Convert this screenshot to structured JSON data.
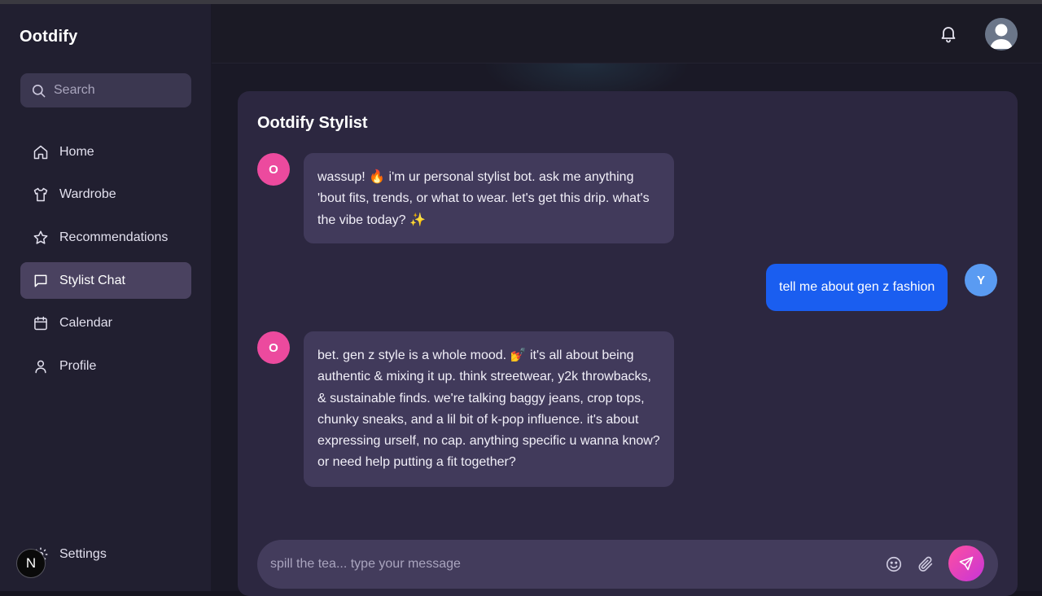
{
  "app": {
    "name": "Ootdify"
  },
  "search": {
    "placeholder": "Search"
  },
  "sidebar": {
    "items": [
      {
        "label": "Home",
        "icon": "home-icon"
      },
      {
        "label": "Wardrobe",
        "icon": "shirt-icon"
      },
      {
        "label": "Recommendations",
        "icon": "star-icon"
      },
      {
        "label": "Stylist Chat",
        "icon": "chat-icon",
        "active": true
      },
      {
        "label": "Calendar",
        "icon": "calendar-icon"
      },
      {
        "label": "Profile",
        "icon": "user-icon"
      }
    ],
    "settings_label": "Settings",
    "badge_letter": "N"
  },
  "header": {
    "icons": [
      "bell-icon",
      "avatar"
    ]
  },
  "chat": {
    "title": "Ootdify Stylist",
    "messages": [
      {
        "sender": "bot",
        "avatar_letter": "O",
        "text": "wassup! 🔥 i'm ur personal stylist bot. ask me anything 'bout fits, trends, or what to wear. let's get this drip. what's the vibe today? ✨"
      },
      {
        "sender": "user",
        "avatar_letter": "Y",
        "text": "tell me about gen z fashion"
      },
      {
        "sender": "bot",
        "avatar_letter": "O",
        "text": "bet. gen z style is a whole mood. 💅 it's all about being authentic & mixing it up. think streetwear, y2k throwbacks, & sustainable finds. we're talking baggy jeans, crop tops, chunky sneaks, and a lil bit of k-pop influence. it's about expressing urself, no cap. anything specific u wanna know? or need help putting a fit together?"
      }
    ],
    "composer": {
      "placeholder": "spill the tea... type your message",
      "value": ""
    }
  },
  "colors": {
    "sidebar_bg": "#211f30",
    "panel_bg": "#2c2740",
    "bot_bubble": "#413a5b",
    "user_bubble": "#1a5ef0",
    "bot_avatar": "#ec4a9e",
    "user_avatar": "#5a9bf2",
    "send_gradient": [
      "#ff4fa0",
      "#c735d8"
    ]
  }
}
